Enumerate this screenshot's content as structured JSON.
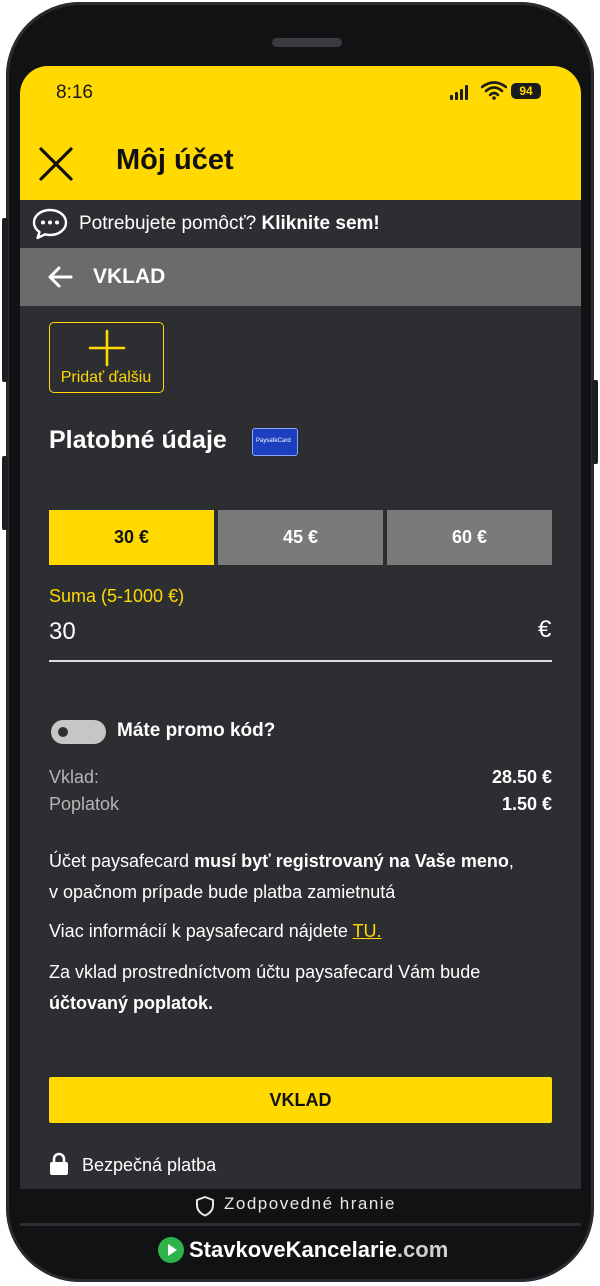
{
  "status_bar": {
    "time": "8:16",
    "battery": "94"
  },
  "header": {
    "title": "Môj účet"
  },
  "help_bar": {
    "text": "Potrebujete pomôcť?",
    "link": "Kliknite sem!"
  },
  "sub_header": {
    "title": "VKLAD"
  },
  "add_card": {
    "label": "Pridať ďalšiu"
  },
  "payment": {
    "title": "Platobné údaje",
    "logo_text": "PaysafeCard"
  },
  "amount_options": [
    "30 €",
    "45 €",
    "60 €"
  ],
  "selected_amount_index": 0,
  "sum": {
    "label": "Suma (5-1000 €)",
    "value": "30",
    "currency": "€"
  },
  "promo": {
    "label": "Máte promo kód?",
    "enabled": false
  },
  "summary": [
    {
      "label": "Vklad:",
      "value": "28.50 €"
    },
    {
      "label": "Poplatok",
      "value": "1.50 €"
    }
  ],
  "info": {
    "p1_a": "Účet paysafecard ",
    "p1_b": "musí byť registrovaný na Vaše meno",
    "p1_c": ",",
    "p1_d": "v opačnom prípade bude platba zamietnutá",
    "p2_a": "Viac informácií k paysafecard nájdete ",
    "p2_link": "TU.",
    "p3_a": "Za vklad prostredníctvom účtu paysafecard Vám bude",
    "p3_b": "účtovaný poplatok."
  },
  "submit_button": {
    "label": "VKLAD"
  },
  "secure_label": "Bezpečná platba",
  "footer": {
    "responsible": "Zodpovedné hranie"
  },
  "brand": {
    "part1": "StavkoveKancelarie",
    "part2": ".com"
  },
  "colors": {
    "accent": "#ffd900",
    "background": "#2d2e32",
    "sub_header": "#6b6b6b",
    "brand_green": "#2db34a"
  },
  "icons": [
    "close-icon",
    "chat-bubble-icon",
    "back-arrow-icon",
    "plus-icon",
    "lock-icon",
    "shield-icon",
    "play-icon",
    "signal-icon",
    "wifi-icon"
  ]
}
